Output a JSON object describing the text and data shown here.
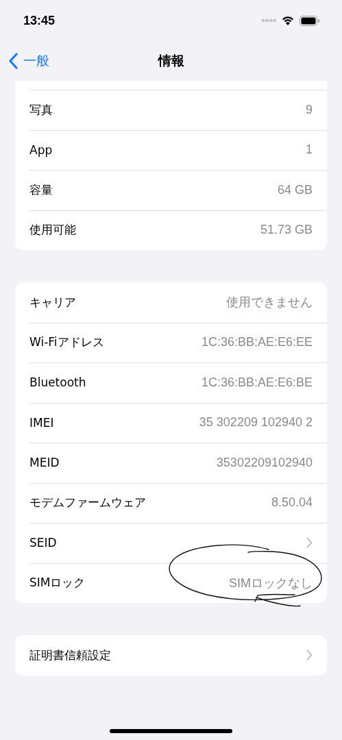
{
  "status_bar": {
    "time": "13:45"
  },
  "nav": {
    "back": "一般",
    "title": "情報"
  },
  "groups": [
    {
      "cut_top": true,
      "rows": [
        {
          "kind": "value",
          "label": "写真",
          "value": "9"
        },
        {
          "kind": "value",
          "label": "App",
          "value": "1"
        },
        {
          "kind": "value",
          "label": "容量",
          "value": "64 GB"
        },
        {
          "kind": "value",
          "label": "使用可能",
          "value": "51.73 GB"
        }
      ]
    },
    {
      "cut_top": false,
      "rows": [
        {
          "kind": "value",
          "label": "キャリア",
          "value": "使用できません"
        },
        {
          "kind": "value",
          "label": "Wi-Fiアドレス",
          "value": "1C:36:BB:AE:E6:EE"
        },
        {
          "kind": "value",
          "label": "Bluetooth",
          "value": "1C:36:BB:AE:E6:BE"
        },
        {
          "kind": "value",
          "label": "IMEI",
          "value": "35 302209 102940 2"
        },
        {
          "kind": "value",
          "label": "MEID",
          "value": "35302209102940"
        },
        {
          "kind": "value",
          "label": "モデムファームウェア",
          "value": "8.50.04"
        },
        {
          "kind": "chevron",
          "label": "SEID"
        },
        {
          "kind": "value",
          "label": "SIMロック",
          "value": "SIMロックなし"
        }
      ]
    },
    {
      "cut_top": false,
      "rows": [
        {
          "kind": "chevron",
          "label": "証明書信頼設定"
        }
      ]
    }
  ]
}
